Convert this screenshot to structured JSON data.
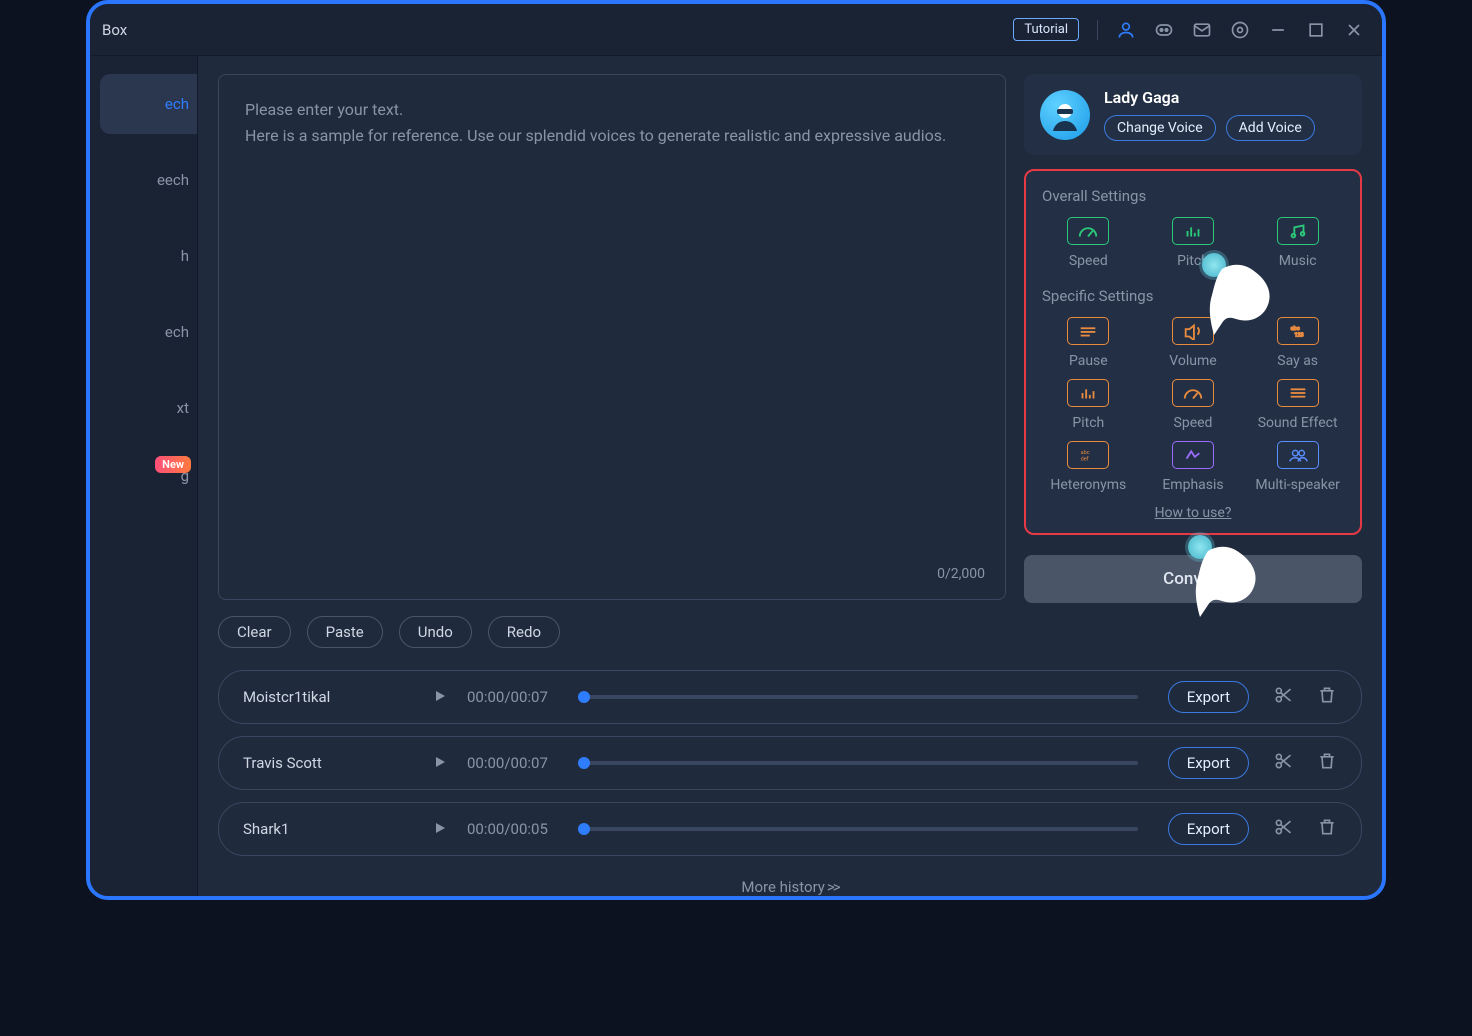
{
  "titlebar": {
    "app_name_fragment": "Box",
    "tutorial_label": "Tutorial"
  },
  "sidebar": {
    "items": [
      {
        "label_fragment": "ech"
      },
      {
        "label_fragment": "eech"
      },
      {
        "label_fragment": "h"
      },
      {
        "label_fragment": "ech"
      },
      {
        "label_fragment": "xt"
      },
      {
        "label_fragment": "g",
        "badge": "New"
      }
    ]
  },
  "editor": {
    "placeholder_line1": "Please enter your text.",
    "placeholder_line2": "Here is a sample for reference. Use our splendid voices to generate realistic and expressive audios.",
    "counter": "0/2,000"
  },
  "actions": {
    "clear": "Clear",
    "paste": "Paste",
    "undo": "Undo",
    "redo": "Redo"
  },
  "voice": {
    "name": "Lady Gaga",
    "change_label": "Change Voice",
    "add_label": "Add Voice"
  },
  "overall_settings": {
    "title": "Overall Settings",
    "items": [
      {
        "label": "Speed"
      },
      {
        "label": "Pitch"
      },
      {
        "label": "Music"
      }
    ]
  },
  "specific_settings": {
    "title": "Specific Settings",
    "items": [
      {
        "label": "Pause"
      },
      {
        "label": "Volume"
      },
      {
        "label": "Say as"
      },
      {
        "label": "Pitch"
      },
      {
        "label": "Speed"
      },
      {
        "label": "Sound Effect"
      },
      {
        "label": "Heteronyms"
      },
      {
        "label": "Emphasis"
      },
      {
        "label": "Multi-speaker"
      }
    ],
    "how_to": "How to use?"
  },
  "convert_label": "Convert",
  "history": {
    "items": [
      {
        "name": "Moistcr1tikal",
        "time": "00:00/00:07",
        "export": "Export"
      },
      {
        "name": "Travis Scott",
        "time": "00:00/00:07",
        "export": "Export"
      },
      {
        "name": "Shark1",
        "time": "00:00/00:05",
        "export": "Export"
      }
    ],
    "more_label": "More history",
    "more_arrows": ">>"
  }
}
